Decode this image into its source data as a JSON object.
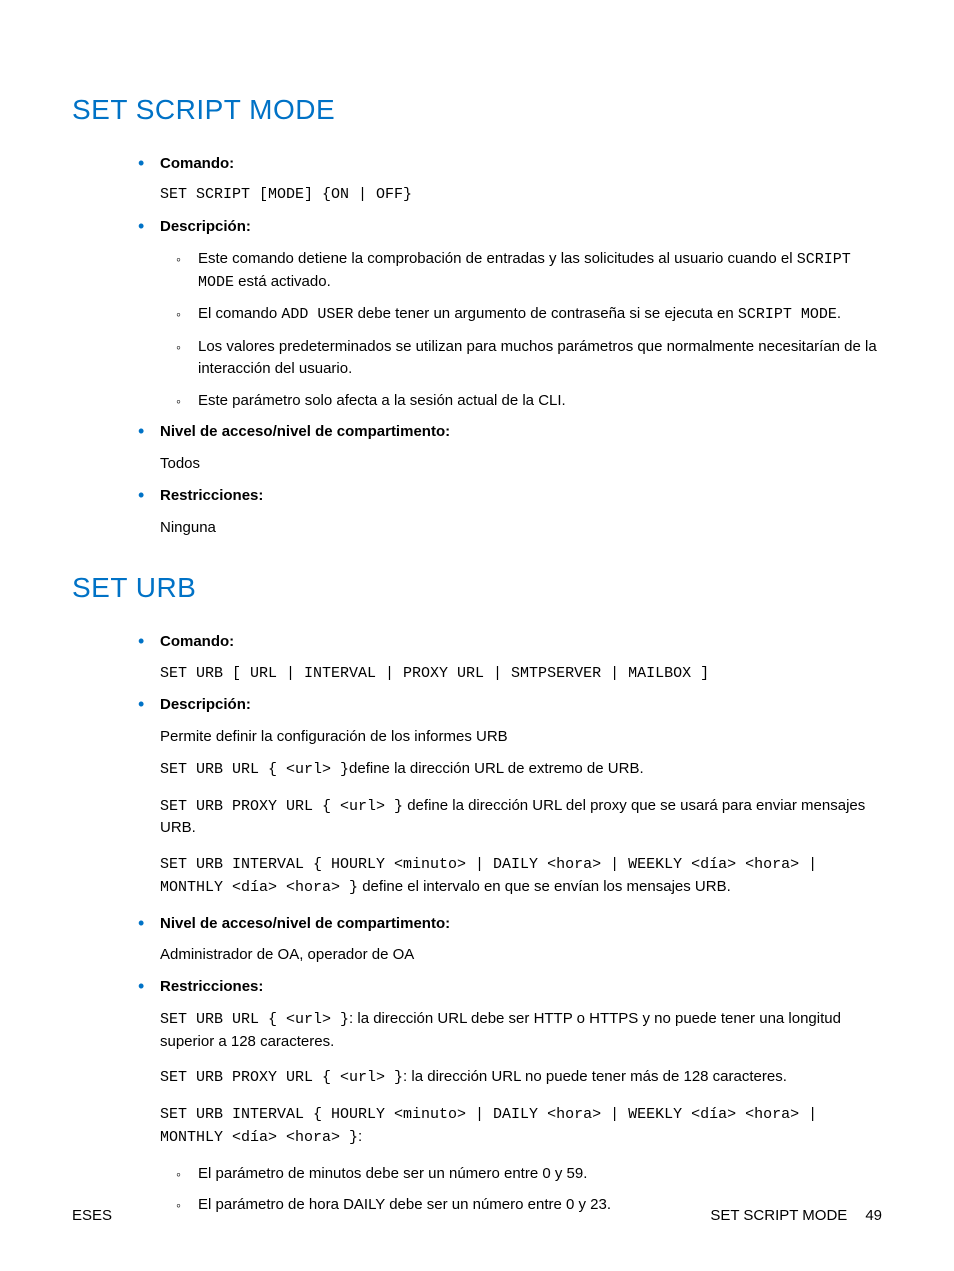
{
  "section1": {
    "heading": "SET SCRIPT MODE",
    "comando_label": "Comando:",
    "comando_code": "SET SCRIPT [MODE] {ON | OFF}",
    "descripcion_label": "Descripción:",
    "desc_item1_pre": "Este comando detiene la comprobación de entradas y las solicitudes al usuario cuando el ",
    "desc_item1_code": "SCRIPT MODE",
    "desc_item1_post": " está activado.",
    "desc_item2_pre": "El comando ",
    "desc_item2_code1": "ADD USER",
    "desc_item2_mid": " debe tener un argumento de contraseña si se ejecuta en ",
    "desc_item2_code2": "SCRIPT MODE",
    "desc_item2_post": ".",
    "desc_item3": "Los valores predeterminados se utilizan para muchos parámetros que normalmente necesitarían de la interacción del usuario.",
    "desc_item4": "Este parámetro solo afecta a la sesión actual de la CLI.",
    "nivel_label": "Nivel de acceso/nivel de compartimento:",
    "nivel_value": "Todos",
    "restr_label": "Restricciones:",
    "restr_value": "Ninguna"
  },
  "section2": {
    "heading": "SET URB",
    "comando_label": "Comando:",
    "comando_code": "SET URB [ URL | INTERVAL | PROXY URL | SMTPSERVER | MAILBOX ]",
    "descripcion_label": "Descripción:",
    "desc_intro": "Permite definir la configuración de los informes URB",
    "desc_p1_code": "SET URB URL { <url> }",
    "desc_p1_text": "define la dirección URL de extremo de URB.",
    "desc_p2_code": "SET URB PROXY URL { <url> }",
    "desc_p2_text": " define la dirección URL del proxy que se usará para enviar mensajes URB.",
    "desc_p3_code": "SET URB INTERVAL { HOURLY <minuto> | DAILY <hora> | WEEKLY <día> <hora> | MONTHLY <día> <hora> }",
    "desc_p3_text": " define el intervalo en que se envían los mensajes URB.",
    "nivel_label": "Nivel de acceso/nivel de compartimento:",
    "nivel_value": "Administrador de OA, operador de OA",
    "restr_label": "Restricciones:",
    "restr_p1_code": "SET URB URL { <url> }",
    "restr_p1_text": ": la dirección URL debe ser HTTP o HTTPS y no puede tener una longitud superior a 128 caracteres.",
    "restr_p2_code": "SET URB PROXY URL { <url> }",
    "restr_p2_text": ": la dirección URL no puede tener más de 128 caracteres.",
    "restr_p3_code": "SET URB INTERVAL { HOURLY <minuto> | DAILY <hora> | WEEKLY <día> <hora> | MONTHLY <día> <hora> }",
    "restr_p3_text": ":",
    "restr_sub1": "El parámetro de minutos debe ser un número entre 0 y 59.",
    "restr_sub2": "El parámetro de hora DAILY debe ser un número entre 0 y 23."
  },
  "footer": {
    "left": "ESES",
    "right_title": "SET SCRIPT MODE",
    "page": "49"
  }
}
